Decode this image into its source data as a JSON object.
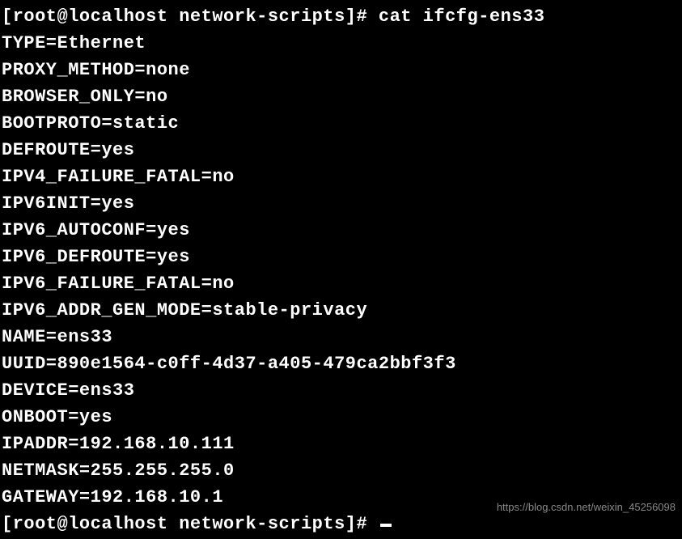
{
  "prompt1": {
    "user": "root",
    "host": "localhost",
    "dir": "network-scripts",
    "symbol": "#",
    "command": "cat ifcfg-ens33"
  },
  "config_lines": [
    "TYPE=Ethernet",
    "PROXY_METHOD=none",
    "BROWSER_ONLY=no",
    "BOOTPROTO=static",
    "DEFROUTE=yes",
    "IPV4_FAILURE_FATAL=no",
    "IPV6INIT=yes",
    "IPV6_AUTOCONF=yes",
    "IPV6_DEFROUTE=yes",
    "IPV6_FAILURE_FATAL=no",
    "IPV6_ADDR_GEN_MODE=stable-privacy",
    "NAME=ens33",
    "UUID=890e1564-c0ff-4d37-a405-479ca2bbf3f3",
    "DEVICE=ens33",
    "ONBOOT=yes",
    "IPADDR=192.168.10.111",
    "NETMASK=255.255.255.0",
    "GATEWAY=192.168.10.1"
  ],
  "prompt2": {
    "user": "root",
    "host": "localhost",
    "dir": "network-scripts",
    "symbol": "#"
  },
  "watermark": "https://blog.csdn.net/weixin_45256098"
}
